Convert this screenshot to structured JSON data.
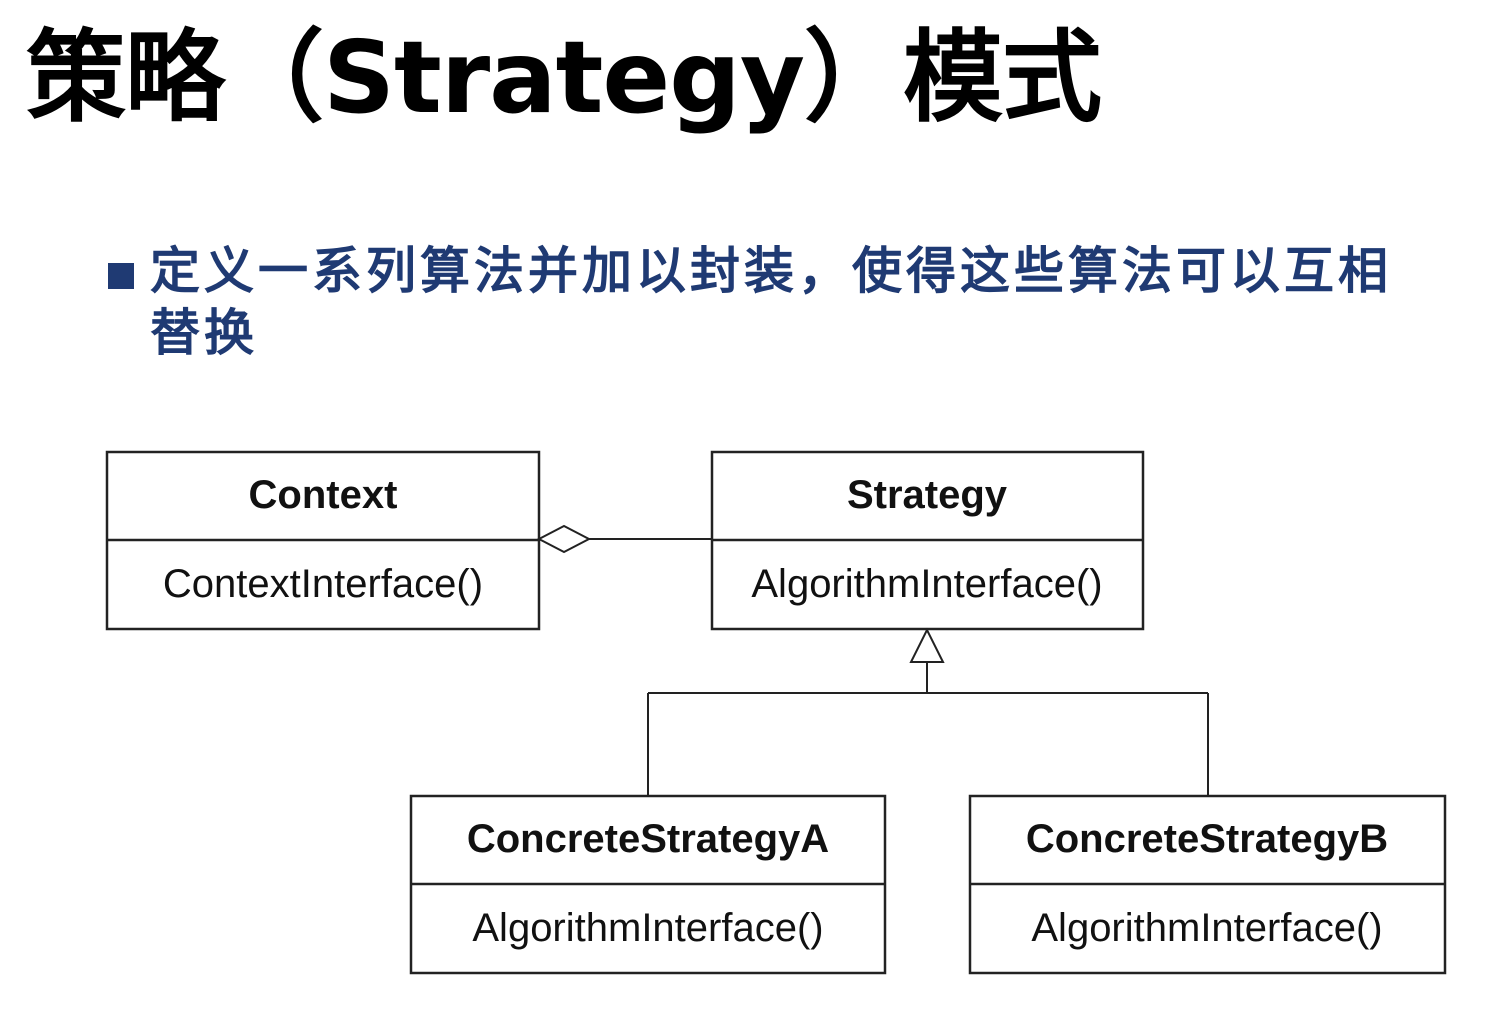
{
  "title": "策略（Strategy）模式",
  "bullet": {
    "text": "定义一系列算法并加以封装，使得这些算法可以互相替换"
  },
  "diagram": {
    "classes": {
      "context": {
        "name": "Context",
        "operation": "ContextInterface()"
      },
      "strategy": {
        "name": "Strategy",
        "operation": "AlgorithmInterface()"
      },
      "concrete_a": {
        "name": "ConcreteStrategyA",
        "operation": "AlgorithmInterface()"
      },
      "concrete_b": {
        "name": "ConcreteStrategyB",
        "operation": "AlgorithmInterface()"
      }
    },
    "relations": [
      {
        "type": "aggregation",
        "from": "Context",
        "to": "Strategy"
      },
      {
        "type": "generalization",
        "from": "ConcreteStrategyA",
        "to": "Strategy"
      },
      {
        "type": "generalization",
        "from": "ConcreteStrategyB",
        "to": "Strategy"
      }
    ]
  }
}
